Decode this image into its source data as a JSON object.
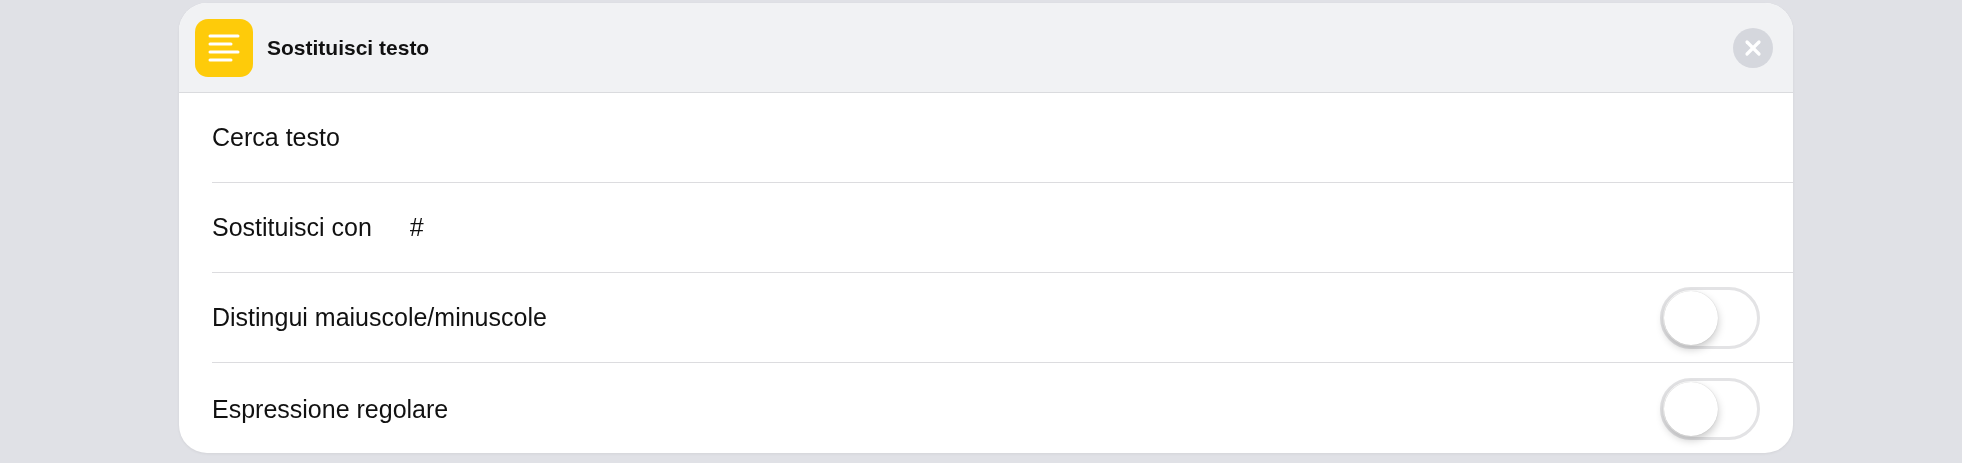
{
  "action": {
    "title": "Sostituisci testo"
  },
  "rows": [
    {
      "kind": "text",
      "label": "Cerca testo"
    },
    {
      "kind": "text",
      "label": "Sostituisci con",
      "value": "#"
    },
    {
      "kind": "toggle",
      "label": "Distingui maiuscole/minuscole",
      "on": false
    },
    {
      "kind": "toggle",
      "label": "Espressione regolare",
      "on": false
    }
  ]
}
